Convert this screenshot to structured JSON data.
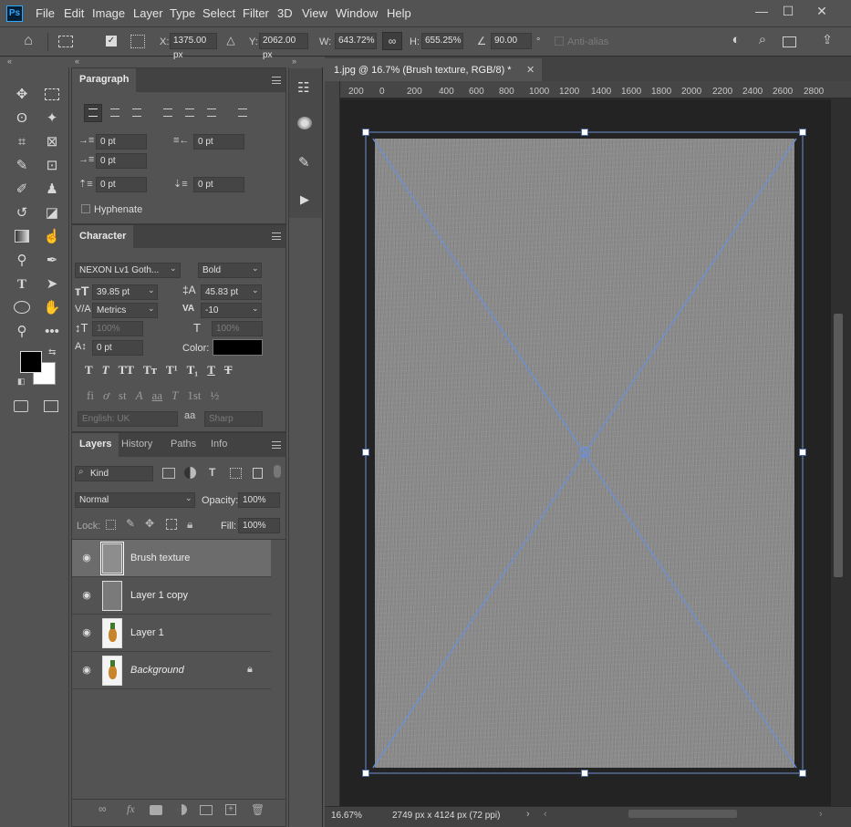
{
  "menu": [
    "File",
    "Edit",
    "Image",
    "Layer",
    "Type",
    "Select",
    "Filter",
    "3D",
    "View",
    "Window",
    "Help"
  ],
  "app_logo": "Ps",
  "window_controls": {
    "minimize": "—",
    "maximize": "☐",
    "close": "✕"
  },
  "options": {
    "x_label": "X:",
    "x_value": "1375.00 px",
    "y_label": "Y:",
    "y_value": "2062.00 px",
    "w_label": "W:",
    "w_value": "643.72%",
    "h_label": "H:",
    "h_value": "655.25%",
    "angle_value": "90.00",
    "angle_unit": "°",
    "antialias": "Anti-alias"
  },
  "paragraph": {
    "tab": "Paragraph",
    "indent_left": "0 pt",
    "indent_right": "0 pt",
    "indent_first": "0 pt",
    "space_before": "0 pt",
    "space_after": "0 pt",
    "hyphenate": "Hyphenate"
  },
  "character": {
    "tab": "Character",
    "font_family": "NEXON Lv1 Goth...",
    "font_style": "Bold",
    "font_size": "39.85 pt",
    "leading": "45.83 pt",
    "kerning": "Metrics",
    "tracking": "-10",
    "vscale": "100%",
    "hscale": "100%",
    "baseline": "0 pt",
    "color_label": "Color:",
    "color": "#000000",
    "language": "English: UK",
    "aa_icon": "aa",
    "antialias": "Sharp",
    "type_styles": [
      "T",
      "T",
      "TT",
      "Tт",
      "T¹",
      "T₁",
      "T",
      "T"
    ],
    "opentype": [
      "fi",
      "ơ",
      "st",
      "A",
      "aa",
      "T",
      "1st",
      "½"
    ]
  },
  "layers_panel": {
    "tabs": [
      "Layers",
      "History",
      "Paths",
      "Info"
    ],
    "kind": "Kind",
    "blend_mode": "Normal",
    "opacity_label": "Opacity:",
    "opacity": "100%",
    "lock_label": "Lock:",
    "fill_label": "Fill:",
    "fill": "100%",
    "layers": [
      {
        "name": "Brush texture",
        "selected": true
      },
      {
        "name": "Layer 1 copy",
        "selected": false
      },
      {
        "name": "Layer 1",
        "selected": false
      },
      {
        "name": "Background",
        "selected": false
      }
    ]
  },
  "document": {
    "tab_title": "1.jpg @ 16.7% (Brush texture, RGB/8) *",
    "zoom": "16.67%",
    "doc_info": "2749 px x 4124 px (72 ppi)",
    "ruler_top": [
      "200",
      "0",
      "200",
      "400",
      "600",
      "800",
      "1000",
      "1200",
      "1400",
      "1600",
      "1800",
      "2000",
      "2200",
      "2400",
      "2600",
      "2800"
    ]
  },
  "colors": {
    "accent": "#31a8ff",
    "transform_line": "#6f8fd0",
    "foreground": "#000000",
    "background": "#ffffff"
  }
}
